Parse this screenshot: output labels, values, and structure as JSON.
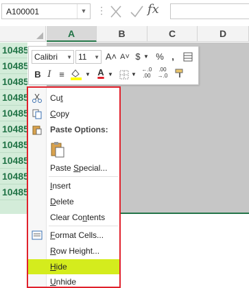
{
  "formula_bar": {
    "name_box": "A100001",
    "dots": "⋮",
    "fx": "fx",
    "formula_value": ""
  },
  "columns": [
    "A",
    "B",
    "C",
    "D"
  ],
  "rows": [
    "1048576",
    "1048576",
    "1048576",
    "1048576",
    "1048576",
    "1048576",
    "1048576",
    "1048576",
    "1048576",
    "1048576"
  ],
  "mini_toolbar": {
    "font_name": "Calibri",
    "font_size": "11",
    "grow_font": "A˄",
    "shrink_font": "A˅",
    "currency": "$",
    "percent": "%",
    "comma": ",",
    "bold": "B",
    "italic": "I",
    "align": "≡",
    "font_color_letter": "A",
    "decimal_increase": "←.0\n.00",
    "decimal_decrease": ".00\n→.0",
    "highlight_color": "#ffff00",
    "font_color": "#e0202b"
  },
  "context_menu": {
    "border_color": "#e0202b",
    "highlight_color": "#d4ec1d",
    "items": [
      {
        "pre": "Cu",
        "u": "t",
        "post": ""
      },
      {
        "pre": "",
        "u": "C",
        "post": "opy"
      },
      {
        "pre": "Paste Options:",
        "u": "",
        "post": ""
      },
      {
        "pre": "Paste ",
        "u": "S",
        "post": "pecial..."
      },
      {
        "pre": "",
        "u": "I",
        "post": "nsert"
      },
      {
        "pre": "",
        "u": "D",
        "post": "elete"
      },
      {
        "pre": "Clear Co",
        "u": "n",
        "post": "tents"
      },
      {
        "pre": "",
        "u": "F",
        "post": "ormat Cells..."
      },
      {
        "pre": "",
        "u": "R",
        "post": "ow Height..."
      },
      {
        "pre": "",
        "u": "H",
        "post": "ide"
      },
      {
        "pre": "",
        "u": "U",
        "post": "nhide"
      }
    ]
  }
}
